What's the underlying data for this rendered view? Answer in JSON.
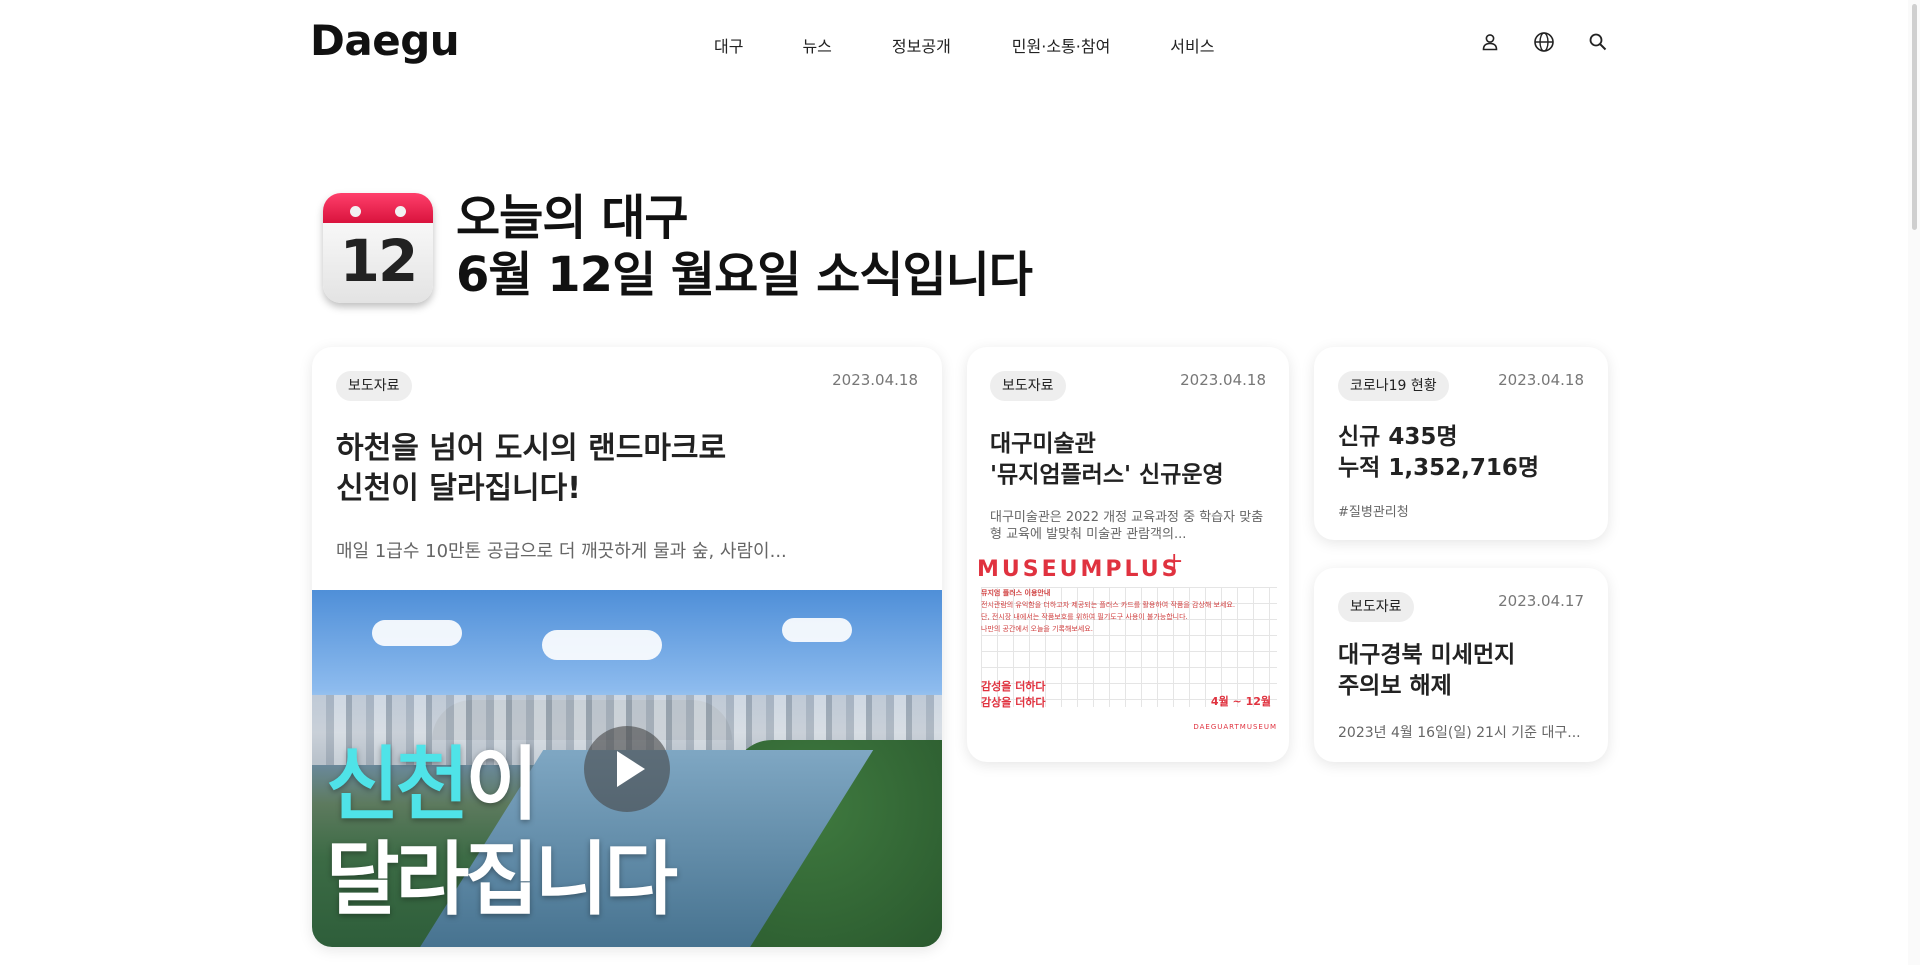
{
  "header": {
    "logo": "Daegu",
    "nav": [
      "대구",
      "뉴스",
      "정보공개",
      "민원·소통·참여",
      "서비스"
    ],
    "icons": [
      "user-icon",
      "globe-icon",
      "search-icon"
    ]
  },
  "hero": {
    "calendar_day": "12",
    "title_line1": "오늘의 대구",
    "title_line2": "6월 12일 월요일 소식입니다"
  },
  "cards": {
    "main": {
      "tag": "보도자료",
      "date": "2023.04.18",
      "title_line1": "하천을 넘어 도시의 랜드마크로",
      "title_line2": "신천이 달라집니다!",
      "desc": "매일 1급수 10만톤 공급으로 더 깨끗하게 물과 숲, 사람이...",
      "video_text_highlight": "신천",
      "video_text_rest": "이",
      "video_text_line2": "달라집니다"
    },
    "museum": {
      "tag": "보도자료",
      "date": "2023.04.18",
      "title_line1": "대구미술관",
      "title_line2": "'뮤지엄플러스' 신규운영",
      "desc": "대구미술관은 2022 개정 교육과정 중 학습자 맞춤형 교육에 발맞춰 미술관 관람객의...",
      "poster": {
        "logo": "MUSEUMPLUS",
        "plus": "+",
        "lines": [
          "뮤지엄 플러스 이용안내",
          "전시관람의 유익함을 더하고자 제공되는 플러스 카드를 활용하여 작품을 감상해 보세요.",
          "단, 전시장 내에서는 작품보호를 위하여 필기도구 사용이 불가능합니다.",
          "나만의 공간에서 오늘을 기록해보세요."
        ],
        "slogan_line1": "감성을 더하다",
        "slogan_line2": "감상을 더하다",
        "period": "4월 ~ 12월",
        "brand": "DAEGUARTMUSEUM"
      }
    },
    "covid": {
      "tag": "코로나19 현황",
      "date": "2023.04.18",
      "line1": "신규 435명",
      "line2": "누적 1,352,716명",
      "hashtag": "#질병관리청"
    },
    "dust": {
      "tag": "보도자료",
      "date": "2023.04.17",
      "title_line1": "대구경북 미세먼지",
      "title_line2": "주의보 해제",
      "desc": "2023년 4월 16일(일) 21시 기준 대구..."
    }
  },
  "colors": {
    "calendar_red": "#e8194a",
    "video_highlight": "#4fe3e8",
    "museum_red": "#e0323f",
    "tag_bg": "#eeeeee"
  }
}
